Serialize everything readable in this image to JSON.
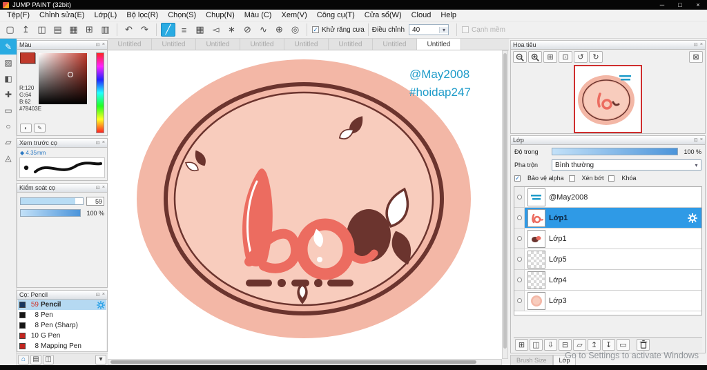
{
  "colors": {
    "accent_blue": "#29abe2",
    "selection_blue": "#2f9ae6",
    "coral": "#ec6c60",
    "dark_brown": "#6b342e",
    "salmon": "#f3b7a6",
    "canvas_text_blue": "#1e9bc9",
    "foreground_color": "#78403E",
    "brush_chip_navy": "#16355e",
    "brush_chip_black": "#161616",
    "brush_chip_red": "#c2251f",
    "navigator_frame_red": "#cf2e2e"
  },
  "window": {
    "title": "JUMP PAINT (32bit)"
  },
  "icons": {
    "minimize": "─",
    "maximize": "□",
    "close": "×",
    "file_new": "▢",
    "file_export": "↥",
    "comment": "◫",
    "panel": "▤",
    "grid": "▦",
    "pages": "⊞",
    "spread": "▥",
    "undo": "↶",
    "redo": "↷",
    "snap_active": "╱",
    "snap_parallel": "≡",
    "snap_grid": "▦",
    "snap_vanish": "◅",
    "snap_radial": "∗",
    "snap_off": "⊘",
    "snap_curve": "∿",
    "snap_cross": "⊕",
    "snap_circle": "◎",
    "check": "✓",
    "combo_arrow": "▾",
    "tool_pen": "✎",
    "tool_eraser": "▨",
    "tool_fill": "◧",
    "tool_move": "✚",
    "tool_select": "▭",
    "tool_shape": "○",
    "tool_grad": "▱",
    "tool_zoom": "◬",
    "home": "⌂",
    "page": "▤",
    "page_copy": "◫",
    "dropdown": "▾",
    "swap": "◐",
    "edit": "✎",
    "brush_marker": "◆",
    "nav_fit": "⊞",
    "nav_orig": "⊡",
    "nav_rot_ccw": "↺",
    "nav_rot_cw": "↻",
    "nav_reset": "⊠",
    "panel_float": "⊡",
    "panel_close": "×",
    "layer_new": "⊞",
    "layer_dup": "◫",
    "layer_down": "⇩",
    "layer_merge": "⊟",
    "layer_folder": "▱",
    "layer_up": "↥",
    "layer_down2": "↧",
    "layer_flat": "▭"
  },
  "menu": {
    "items": [
      "Tệp(F)",
      "Chỉnh sửa(E)",
      "Lớp(L)",
      "Bộ lọc(R)",
      "Chọn(S)",
      "Chụp(N)",
      "Màu (C)",
      "Xem(V)",
      "Công cụ(T)",
      "Cửa sổ(W)",
      "Cloud",
      "Help"
    ]
  },
  "toolbar": {
    "antialias_label": "Khử răng cưa",
    "adjust_label": "Điều chỉnh",
    "adjust_value": "40",
    "soft_edge_label": "Cạnh mềm"
  },
  "tabs": {
    "items": [
      "Untitled",
      "Untitled",
      "Untitled",
      "Untitled",
      "Untitled",
      "Untitled",
      "Untitled",
      "Untitled"
    ],
    "active_index": 7
  },
  "canvas": {
    "handle": "@May2008",
    "hashtag": "#hoidap247"
  },
  "color_panel": {
    "title": "Màu",
    "r_label": "R:120",
    "g_label": "G:64",
    "b_label": "B:62",
    "hex_label": "#78403E"
  },
  "brush_preview_panel": {
    "title": "Xem trước cọ",
    "size_label": "4.35mm"
  },
  "brush_control_panel": {
    "title": "Kiểm soát cọ",
    "size_value": "59",
    "opacity_value": "100 %"
  },
  "brush_panel": {
    "title": "Cọ: Pencil",
    "items": [
      {
        "size": "59",
        "name": "Pencil",
        "selected": true
      },
      {
        "size": "8",
        "name": "Pen",
        "selected": false
      },
      {
        "size": "8",
        "name": "Pen (Sharp)",
        "selected": false
      },
      {
        "size": "10",
        "name": "G Pen",
        "selected": false
      },
      {
        "size": "8",
        "name": "Mapping Pen",
        "selected": false
      }
    ]
  },
  "navigator_panel": {
    "title": "Hoa tiêu"
  },
  "layer_panel": {
    "title": "Lớp",
    "opacity_label": "Độ trong",
    "opacity_value": "100 %",
    "blend_label": "Pha trộn",
    "blend_value": "Bình thường",
    "protect_alpha_label": "Bảo vệ alpha",
    "clipping_label": "Xén bớt",
    "lock_label": "Khóa",
    "items": [
      {
        "name": "@May2008",
        "selected": false
      },
      {
        "name": "Lớp1",
        "selected": true
      },
      {
        "name": "Lớp1",
        "selected": false
      },
      {
        "name": "Lớp5",
        "selected": false
      },
      {
        "name": "Lớp4",
        "selected": false
      },
      {
        "name": "Lớp3",
        "selected": false
      }
    ]
  },
  "bottom": {
    "tab_brush_size": "Brush Size",
    "tab_layer": "Lớp",
    "watermark": "Go to Settings to activate Windows"
  }
}
